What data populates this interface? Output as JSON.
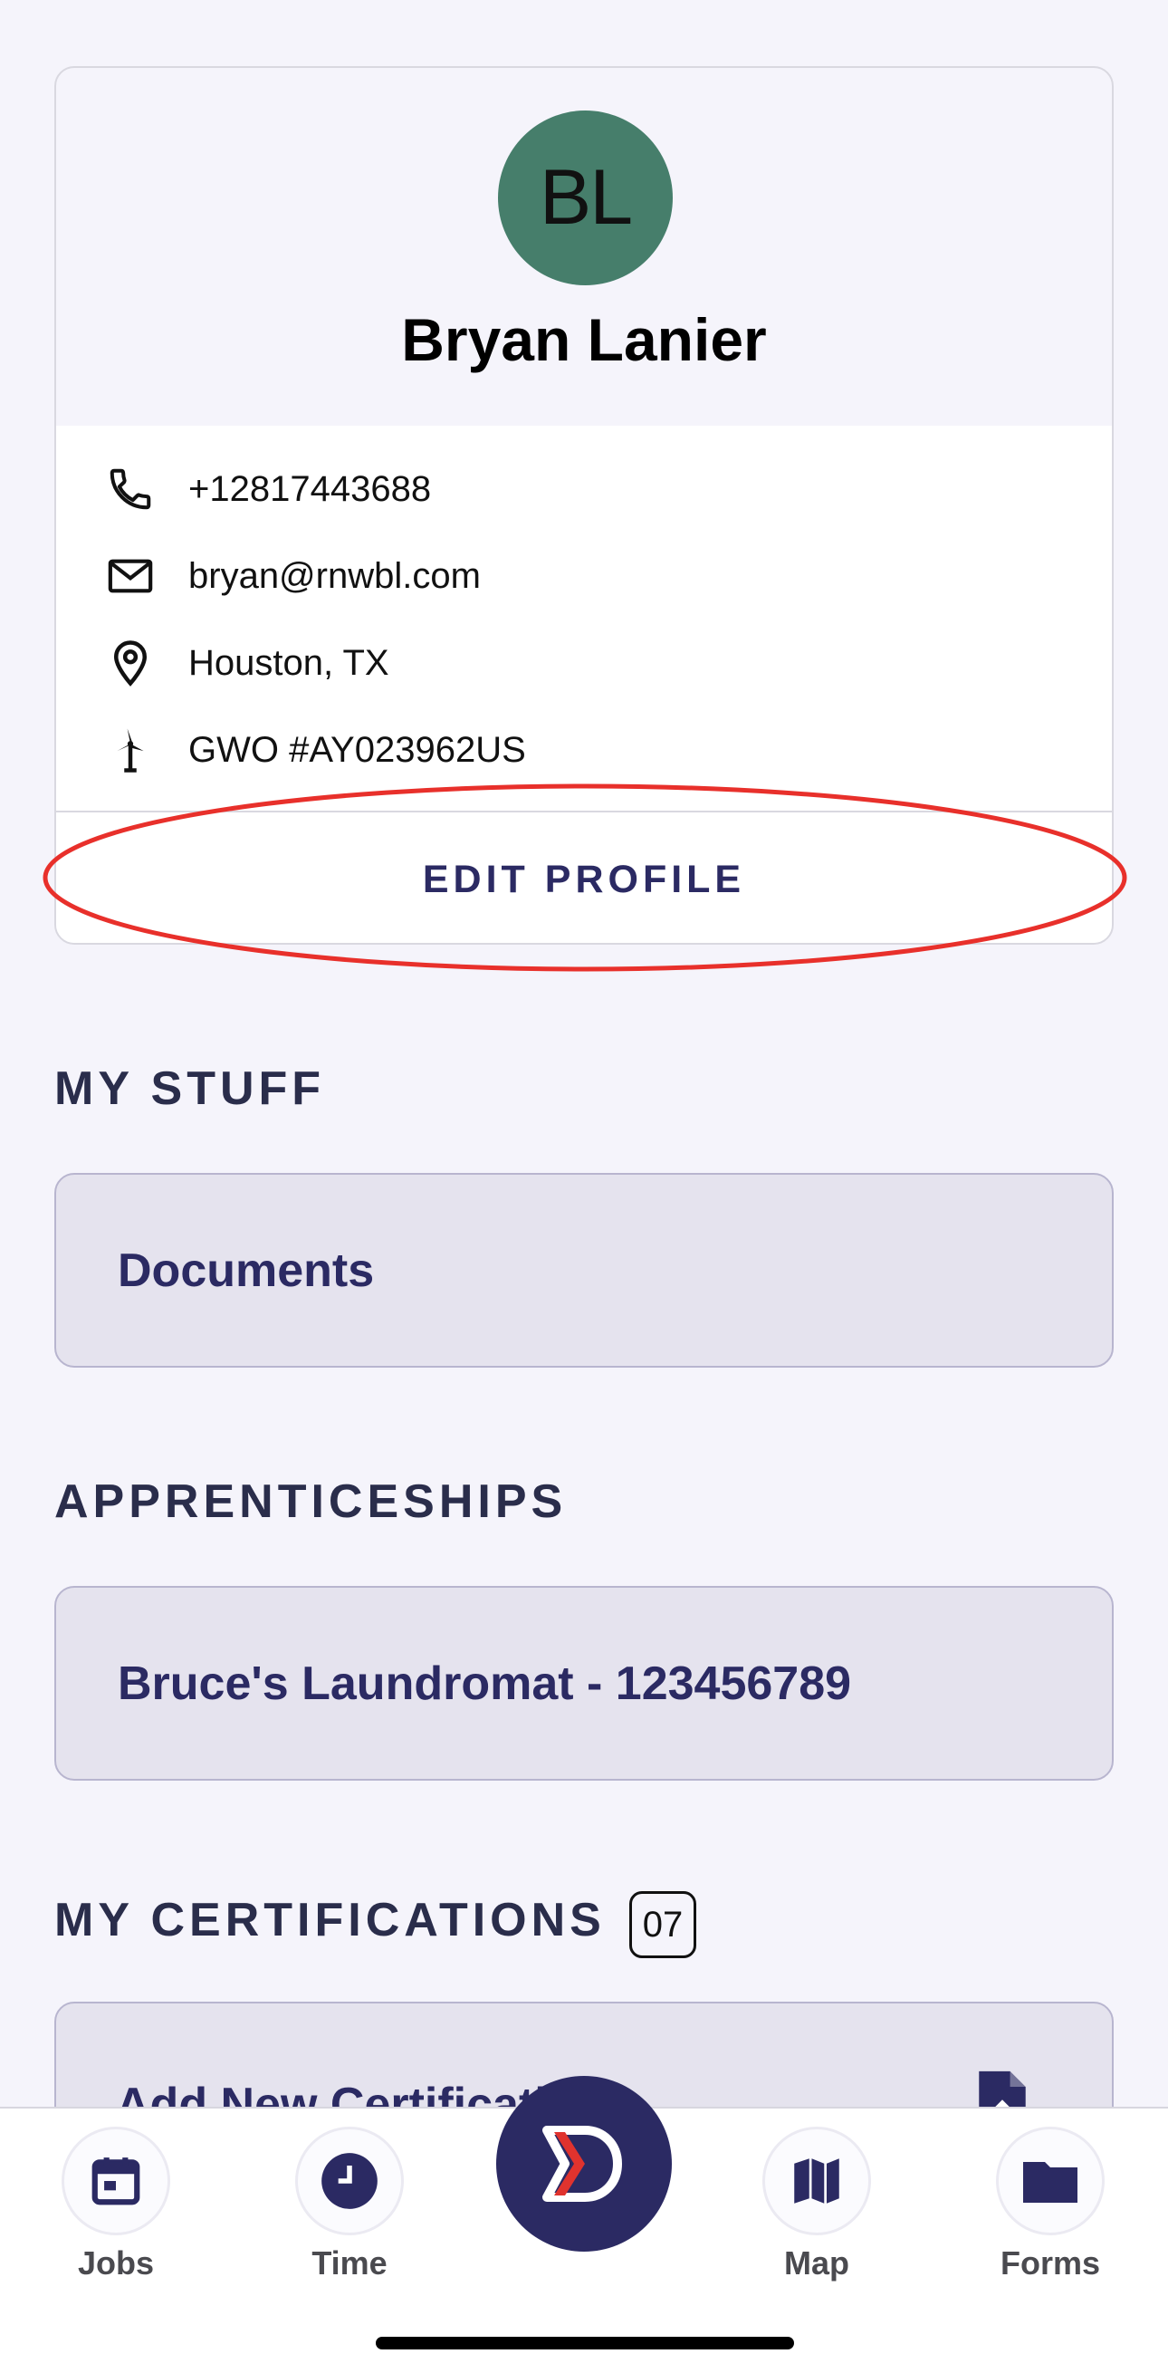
{
  "profile": {
    "initials": "BL",
    "avatar_color": "#467e6b",
    "name": "Bryan Lanier",
    "phone": "+12817443688",
    "email": "bryan@rnwbl.com",
    "location": "Houston, TX",
    "gwo": "GWO #AY023962US",
    "edit_label": "EDIT PROFILE"
  },
  "sections": {
    "my_stuff_title": "MY STUFF",
    "documents_label": "Documents",
    "apprenticeships_title": "APPRENTICESHIPS",
    "apprenticeship_item": "Bruce's Laundromat - 123456789",
    "certifications_title": "MY CERTIFICATIONS",
    "certifications_count": "07",
    "add_certification_label": "Add New Certification"
  },
  "tabs": {
    "jobs": "Jobs",
    "time": "Time",
    "map": "Map",
    "forms": "Forms"
  },
  "colors": {
    "brand_navy": "#2b2a63",
    "accent_red": "#e0332e",
    "annotation_red": "#e8302b",
    "background": "#f5f4fb"
  }
}
